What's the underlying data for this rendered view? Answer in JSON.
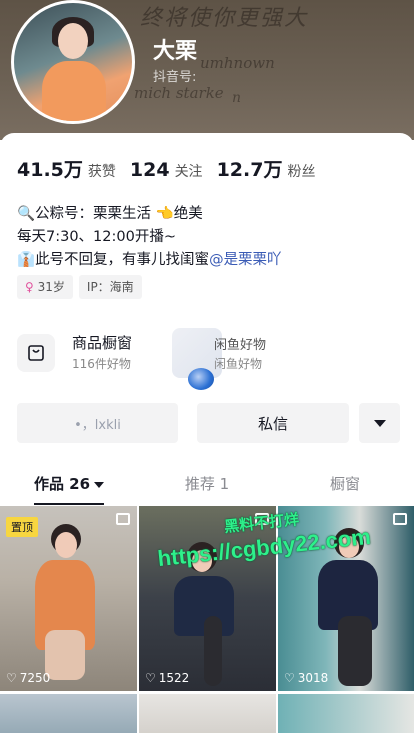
{
  "profile": {
    "name": "大栗",
    "handle": "抖音号:",
    "header_scribbles": [
      "终将使你更强大",
      "umhnown",
      "mich starke",
      "n"
    ]
  },
  "stats": [
    {
      "value": "41.5万",
      "label": "获赞"
    },
    {
      "value": "124",
      "label": "关注"
    },
    {
      "value": "12.7万",
      "label": "粉丝"
    }
  ],
  "bio": {
    "line1_icon": "🔍",
    "line1": "公粽号：栗栗生活",
    "line1_emoji": "👈",
    "line1_tail": "绝美",
    "line2": "每天7:30、12:00开播~",
    "line3_icon": "👔",
    "line3": "此号不回复，有事儿找闺蜜",
    "line3_mention": "@是栗栗吖"
  },
  "tags": [
    {
      "icon": "♀",
      "label": "31岁"
    },
    {
      "icon": "",
      "label": "IP：海南"
    }
  ],
  "shop": {
    "title": "商品橱窗",
    "subtitle": "116件好物",
    "icon": "bag-icon"
  },
  "shop2": {
    "title": "闲鱼好物",
    "subtitle": "闲鱼好物"
  },
  "actions": {
    "follow_label": "•，lxkli",
    "message_label": "私信",
    "more_icon": "triangle-down-icon"
  },
  "tabs": [
    {
      "label": "作品 26"
    },
    {
      "label": "推荐 1"
    },
    {
      "label": "橱窗"
    }
  ],
  "videos": [
    {
      "pinned_label": "置顶",
      "likes": "7250"
    },
    {
      "likes": "1522"
    },
    {
      "likes": "3018"
    }
  ],
  "watermark": {
    "line1": "黑料不打烊",
    "line2": "https://cgbdy22.com"
  }
}
